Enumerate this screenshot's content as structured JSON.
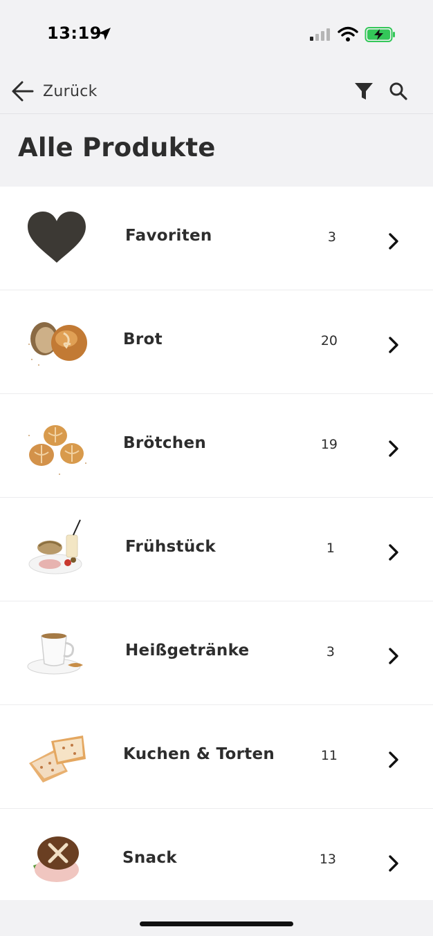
{
  "status_bar": {
    "time": "13:19"
  },
  "nav": {
    "back_label": "Zurück"
  },
  "page": {
    "title": "Alle Produkte"
  },
  "categories": [
    {
      "label": "Favoriten",
      "count": "3",
      "icon": "heart-icon"
    },
    {
      "label": "Brot",
      "count": "20",
      "icon": "bread-image"
    },
    {
      "label": "Brötchen",
      "count": "19",
      "icon": "rolls-image"
    },
    {
      "label": "Frühstück",
      "count": "1",
      "icon": "breakfast-image"
    },
    {
      "label": "Heißgetränke",
      "count": "3",
      "icon": "coffee-cup-image"
    },
    {
      "label": "Kuchen & Torten",
      "count": "11",
      "icon": "cake-image"
    },
    {
      "label": "Snack",
      "count": "13",
      "icon": "snack-image"
    }
  ],
  "colors": {
    "background": "#f2f2f4",
    "text": "#2d2d2d",
    "battery": "#34c759"
  }
}
